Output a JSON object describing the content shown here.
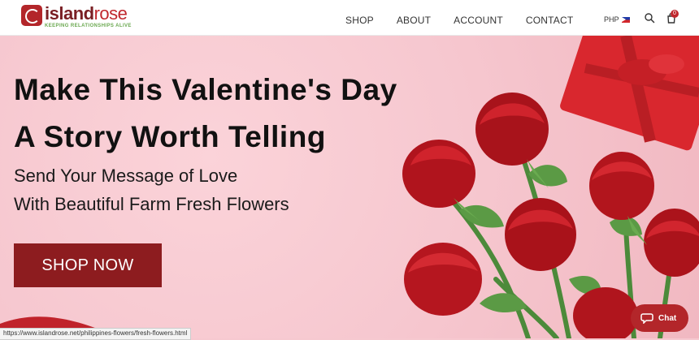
{
  "brand": {
    "name_part1": "island",
    "name_part2": "rose",
    "tagline": "KEEPING RELATIONSHIPS ALIVE"
  },
  "nav": {
    "items": [
      {
        "label": "SHOP"
      },
      {
        "label": "ABOUT"
      },
      {
        "label": "ACCOUNT"
      },
      {
        "label": "CONTACT"
      }
    ],
    "currency": "PHP",
    "cart_count": "0"
  },
  "hero": {
    "headline_line1": "Make This Valentine's Day",
    "headline_line2": "A Story Worth Telling",
    "sub_line1": "Send Your Message of Love",
    "sub_line2": "With Beautiful Farm Fresh Flowers",
    "cta_label": "SHOP NOW"
  },
  "status_bar": {
    "url": "https://www.islandrose.net/philippines-flowers/fresh-flowers.html"
  },
  "chat": {
    "label": "Chat"
  },
  "colors": {
    "brand_red": "#c0272d",
    "cta_red": "#8d1c1f",
    "hero_pink": "#f6c7cf",
    "tagline_green": "#6aa84f"
  }
}
